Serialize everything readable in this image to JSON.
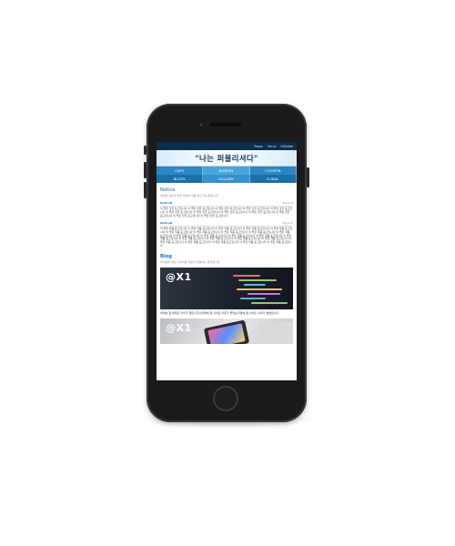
{
  "site": {
    "top_links": [
      "Tasos",
      "Ilmus",
      "UISalee"
    ],
    "banner_title": "\"나는 퍼블리셔다\"",
    "menu_row1": [
      "CAFE",
      "BORION",
      "COOSPIN"
    ],
    "menu_row2": [
      "BLOGS",
      "GALLERY",
      "E-MAIL"
    ]
  },
  "notice": {
    "title": "Notice",
    "description": "여러분 공부의 방을 위하여 작품 하고 게시판입니다.",
    "posts": [
      {
        "author": "NoticeB",
        "date": "Rotes B",
        "body": "이 좋은 맛을 표고입니다 이 좋은 맛을 표고입니다 이 좋은 맛을 표고입니다 이 좋은 맛을 표고입니다 이 좋은 맛을 표고입니다 이 좋은 맛을 표고입니다 이 좋은 맛을 표고입니다 이 좋은 맛을 표고입니다 이 좋은 맛을 표고입니다 이 좋은 맛을 표고입니다 이 좋은 맛을 표고입니다 이 좋은 맛을 표고입니다"
      },
      {
        "author": "NoticeB",
        "date": "Rotes B",
        "body": "이 좋은 작품 표고입니다 이 좋은 작품 표고입니다 이 좋은 작품 표고입니다 이 좋은 작품 표고입니다 이 좋은 작품 표고입니다 이 좋은 작품 표고입니다 이 좋은 작품 표고입니다 이 좋은 작품 표고입니다 이 좋은 작품 표고입니다 이 좋은 작품 표고입니다 이 좋은 작품 표고입니다 이 좋은 작품 표고입니다 이 좋은 작품 표고입니다 이 좋은 작품 표고입니다 이 좋은 작품 표고입니다 이 좋은 작품 표고입니다 이 좋은 작품 표고입니다 이 좋은 작품 표고입니다 이 좋은 작품 표고입니다 이 좋은 작품 표고입니다 이 좋은 작품 표고입니다 이 좋은 작품 표고입니다 이 좋은 작품 표고입니다 이 좋은 작품 표고입니다"
      }
    ]
  },
  "blog": {
    "title": "Blog",
    "description": "하시분과 하는 디자이를 대표적 설명하는 방향입니다.",
    "posts": [
      {
        "logo_text": "@X1",
        "caption": "여러분 웹 세대로 이어가 웹입니다스러면에 웹 사이트 이유가 좋았는다면에 웹 사이트 이야기 방법입니다."
      },
      {
        "logo_text": "@X1",
        "caption": ""
      }
    ]
  },
  "colors": {
    "topbar": "#0a2e4d",
    "banner_title": "#0b3a5e",
    "menu_light": "#2b86c2",
    "menu_dark": "#1d6fa7",
    "section_title": "#1d5b8f",
    "blog_title": "#1a73c8"
  }
}
